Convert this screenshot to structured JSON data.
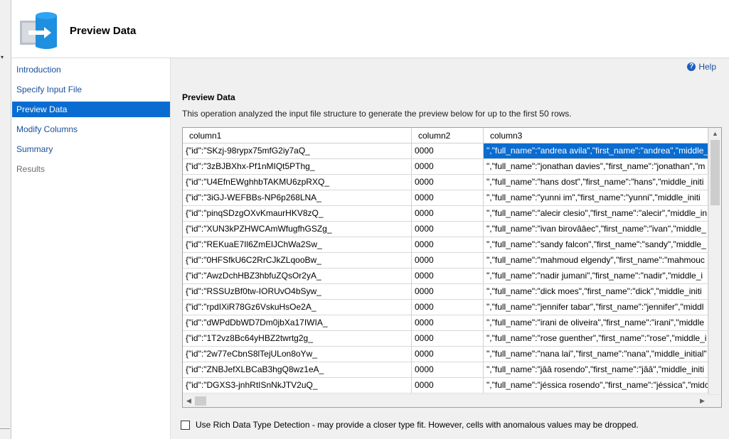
{
  "header": {
    "title": "Preview Data"
  },
  "nav": {
    "items": [
      {
        "label": "Introduction",
        "state": "normal"
      },
      {
        "label": "Specify Input File",
        "state": "normal"
      },
      {
        "label": "Preview Data",
        "state": "active"
      },
      {
        "label": "Modify Columns",
        "state": "normal"
      },
      {
        "label": "Summary",
        "state": "normal"
      },
      {
        "label": "Results",
        "state": "disabled"
      }
    ]
  },
  "main": {
    "help_label": "Help",
    "section_title": "Preview Data",
    "section_description": "This operation analyzed the input file structure to generate the preview below for up to the first 50 rows.",
    "grid": {
      "columns": [
        "column1",
        "column2",
        "column3"
      ],
      "rows": [
        [
          "{\"id\":\"SKzj-98rypx75mfG2iy7aQ_",
          "0000",
          "\",\"full_name\":\"andrea avila\",\"first_name\":\"andrea\",\"middle_"
        ],
        [
          "{\"id\":\"3zBJBXhx-Pf1nMIQt5PThg_",
          "0000",
          "\",\"full_name\":\"jonathan davies\",\"first_name\":\"jonathan\",\"m"
        ],
        [
          "{\"id\":\"U4EfnEWghhbTAKMU6zpRXQ_",
          "0000",
          "\",\"full_name\":\"hans dost\",\"first_name\":\"hans\",\"middle_initi"
        ],
        [
          "{\"id\":\"3iGJ-WEFBBs-NP6p268LNA_",
          "0000",
          "\",\"full_name\":\"yunni im\",\"first_name\":\"yunni\",\"middle_initi"
        ],
        [
          "{\"id\":\"pinqSDzgOXvKmaurHKV8zQ_",
          "0000",
          "\",\"full_name\":\"alecir clesio\",\"first_name\":\"alecir\",\"middle_in"
        ],
        [
          "{\"id\":\"XUN3kPZHWCAmWfugfhGSZg_",
          "0000",
          "\",\"full_name\":\"ivan birovââec\",\"first_name\":\"ivan\",\"middle_"
        ],
        [
          "{\"id\":\"REKuaE7Il6ZmElJChWa2Sw_",
          "0000",
          "\",\"full_name\":\"sandy falcon\",\"first_name\":\"sandy\",\"middle_"
        ],
        [
          "{\"id\":\"0HFSfkU6C2RrCJkZLqooBw_",
          "0000",
          "\",\"full_name\":\"mahmoud elgendy\",\"first_name\":\"mahmouc"
        ],
        [
          "{\"id\":\"AwzDchHBZ3hbfuZQsOr2yA_",
          "0000",
          "\",\"full_name\":\"nadir jumani\",\"first_name\":\"nadir\",\"middle_i"
        ],
        [
          "{\"id\":\"RSSUzBf0tw-IORUvO4bSyw_",
          "0000",
          "\",\"full_name\":\"dick moes\",\"first_name\":\"dick\",\"middle_initi"
        ],
        [
          "{\"id\":\"rpdIXiR78Gz6VskuHsOe2A_",
          "0000",
          "\",\"full_name\":\"jennifer tabar\",\"first_name\":\"jennifer\",\"middl"
        ],
        [
          "{\"id\":\"dWPdDbWD7Dm0jbXa17IWIA_",
          "0000",
          "\",\"full_name\":\"irani de oliveira\",\"first_name\":\"irani\",\"middle"
        ],
        [
          "{\"id\":\"1T2vz8Bc64yHBZ2twrtg2g_",
          "0000",
          "\",\"full_name\":\"rose guenther\",\"first_name\":\"rose\",\"middle_i"
        ],
        [
          "{\"id\":\"2w77eCbnS8lTejULon8oYw_",
          "0000",
          "\",\"full_name\":\"nana lai\",\"first_name\":\"nana\",\"middle_initial\""
        ],
        [
          "{\"id\":\"ZNBJefXLBCaB3hgQ8wz1eA_",
          "0000",
          "\",\"full_name\":\"jââ rosendo\",\"first_name\":\"jââ\",\"middle_initi"
        ],
        [
          "{\"id\":\"DGXS3-jnhRtISnNkJTV2uQ_",
          "0000",
          "\",\"full_name\":\"jéssica rosendo\",\"first_name\":\"jéssica\",\"midc"
        ]
      ],
      "selected_cell": {
        "row": 0,
        "col": 2
      }
    },
    "rich_detection": {
      "label": "Use Rich Data Type Detection - may provide a closer type fit. However, cells with anomalous values may be dropped.",
      "checked": false
    }
  },
  "icons": {
    "header": "database-import-icon",
    "help": "help-icon"
  },
  "colors": {
    "accent": "#0a6cd0",
    "link": "#1a4f99",
    "panel_bg": "#f0f0f0"
  }
}
